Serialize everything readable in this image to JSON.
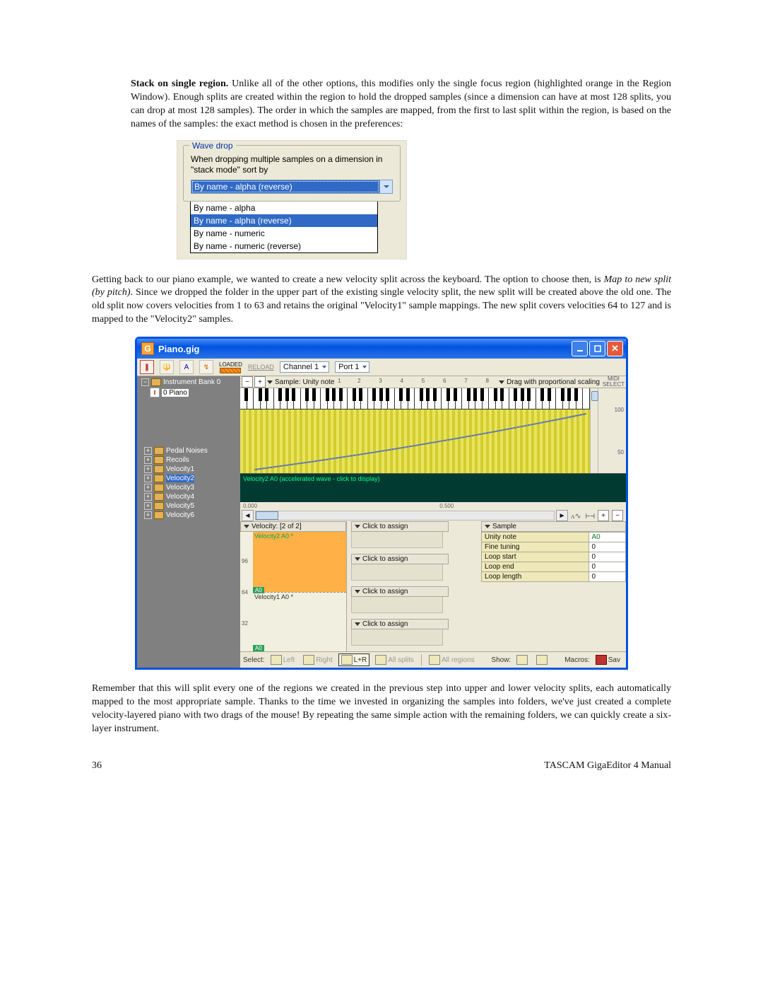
{
  "prose": {
    "para1_strong": "Stack on single region.",
    "para1_rest": "  Unlike all of the other options, this modifies only the single focus region (highlighted orange in the Region Window).  Enough splits are created within the region to hold the dropped samples (since a dimension can have at most 128 splits, you can drop at most 128 samples).  The order in which the samples are mapped, from the first to last split within the region, is based on the names of the samples: the exact method is chosen in the preferences:",
    "para2_a": "Getting back to our piano example, we wanted to create a new velocity split across the keyboard.  The option to choose then, is ",
    "para2_em": "Map to new split (by pitch)",
    "para2_b": ".  Since we dropped the folder in the upper part of the existing single velocity split, the new split will be created above the old one.  The old split now covers velocities from 1 to 63 and retains the original \"Velocity1\" sample mappings.  The new split covers velocities 64 to 127 and is mapped to the \"Velocity2\" samples.",
    "para3": "Remember that this will split every one of the regions we created in the previous step into upper and lower velocity splits, each automatically mapped to the most appropriate sample.  Thanks to the time we invested in organizing the samples into folders, we've just created a complete velocity-layered piano with two drags of the mouse!  By repeating the same simple action with the remaining folders, we can quickly create a six-layer instrument."
  },
  "wave_drop": {
    "group_title": "Wave drop",
    "label": "When dropping multiple samples on a dimension in \"stack mode\" sort by",
    "selected": "By name - alpha (reverse)",
    "options": [
      "By name - alpha",
      "By name - alpha (reverse)",
      "By name - numeric",
      "By name - numeric (reverse)"
    ]
  },
  "gig": {
    "title": "Piano.gig",
    "icon_letter": "G",
    "toolbar": {
      "loaded": "LOADED",
      "reload": "RELOAD",
      "channel": "Channel 1",
      "port": "Port 1"
    },
    "tree": {
      "bank": "Instrument Bank 0",
      "inst": "0 Piano",
      "folders": [
        "Pedal Noises",
        "Recoils",
        "Velocity1",
        "Velocity2",
        "Velocity3",
        "Velocity4",
        "Velocity5",
        "Velocity6"
      ],
      "selected_folder": "Velocity2"
    },
    "kbd": {
      "sample_label": "Sample: Unity note",
      "drag_label": "Drag with proportional scaling",
      "midi_select": "MIDI\nSELECT",
      "octaves": [
        "1",
        "2",
        "3",
        "4",
        "5",
        "6",
        "7",
        "8"
      ],
      "side_marks": [
        "100",
        "50"
      ]
    },
    "wave": {
      "caption": "Velocity2 A0 (accelerated wave - click to display)"
    },
    "time": {
      "start": "0.000",
      "mid": "0.500"
    },
    "zoom_icons": {
      "wave": "ᴧ∿",
      "range": "⊢⊣",
      "plus": "+",
      "minus": "−"
    },
    "velocity": {
      "header": "Velocity: [2 of 2]",
      "upper": "Velocity2 A0 *",
      "lower": "Velocity1 A0 *",
      "tag_top": "A0",
      "tag_bot": "A0",
      "ticks": [
        "96",
        "64",
        "32"
      ]
    },
    "assign": {
      "label": "Click to assign"
    },
    "sample": {
      "header": "Sample",
      "rows": [
        {
          "k": "Unity note",
          "v": "A0"
        },
        {
          "k": "Fine tuning",
          "v": "0"
        },
        {
          "k": "Loop start",
          "v": "0"
        },
        {
          "k": "Loop end",
          "v": "0"
        },
        {
          "k": "Loop length",
          "v": "0"
        }
      ]
    },
    "status": {
      "select": "Select:",
      "left": "Left",
      "right": "Right",
      "lr": "L+R",
      "allsplits": "All splits",
      "allregions": "All regions",
      "show": "Show:",
      "macros": "Macros:",
      "save": "Sav"
    }
  },
  "footer": {
    "page": "36",
    "title": "TASCAM GigaEditor 4 Manual"
  }
}
